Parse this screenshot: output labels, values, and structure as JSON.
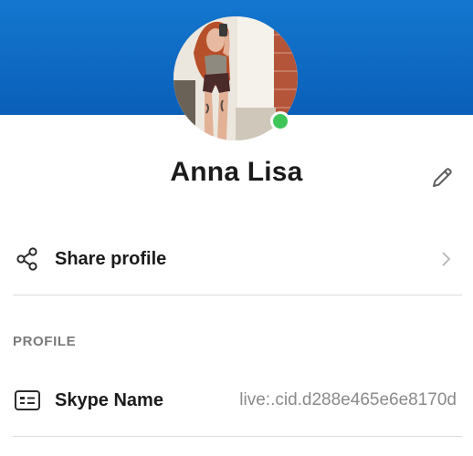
{
  "profile": {
    "name": "Anna Lisa",
    "status_color": "#3fc65a",
    "header_color": "#0f6cc6"
  },
  "actions": {
    "edit_icon": "pencil-icon",
    "share_label": "Share profile",
    "share_icon": "share-icon",
    "chevron_icon": "chevron-right-icon"
  },
  "section": {
    "header": "PROFILE"
  },
  "fields": {
    "skype_name_label": "Skype Name",
    "skype_name_value": "live:.cid.d288e465e6e8170d",
    "skype_name_icon": "id-card-icon"
  }
}
